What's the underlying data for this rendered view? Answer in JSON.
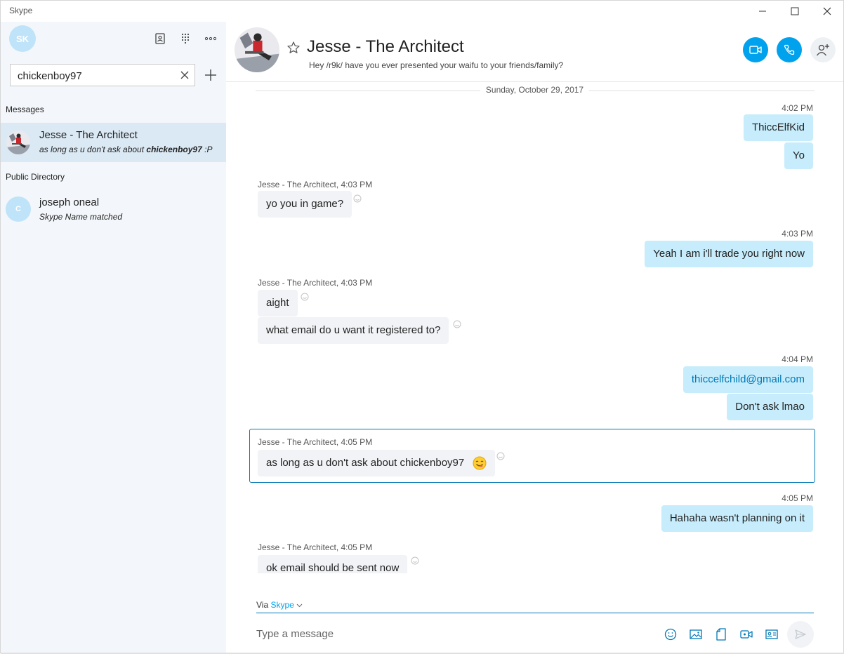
{
  "app": {
    "title": "Skype"
  },
  "window_controls": {
    "minimize_icon": "minimize-icon",
    "maximize_icon": "maximize-icon",
    "close_icon": "close-icon"
  },
  "sidebar": {
    "profile_initials": "SK",
    "icons": [
      "contacts-icon",
      "dialpad-icon",
      "more-icon"
    ],
    "search": {
      "value": "chickenboy97",
      "placeholder": ""
    },
    "messages_label": "Messages",
    "conversations": [
      {
        "name": "Jesse - The Architect",
        "preview_prefix": "as long as u don't ask about ",
        "preview_bold": "chickenboy97",
        "preview_suffix": " :P",
        "selected": true
      }
    ],
    "directory_label": "Public Directory",
    "directory_results": [
      {
        "initials": "C",
        "name": "joseph oneal",
        "match": "Skype Name matched"
      }
    ]
  },
  "header": {
    "title": "Jesse - The Architect",
    "mood": "Hey /r9k/ have you ever presented your waifu to your friends/family?",
    "buttons": [
      "video-call-button",
      "audio-call-button",
      "add-people-button"
    ]
  },
  "conversation": {
    "date": "Sunday, October 29, 2017",
    "meta": {
      "out1": "4:02 PM",
      "in1": "Jesse - The Architect, 4:03 PM",
      "out2": "4:03 PM",
      "in2": "Jesse - The Architect, 4:03 PM",
      "out3": "4:04 PM",
      "in3": "Jesse - The Architect, 4:05 PM",
      "out4": "4:05 PM",
      "in4": "Jesse - The Architect, 4:05 PM"
    },
    "messages": {
      "m1": "ThiccElfKid",
      "m2": "Yo",
      "m3": "yo you in game?",
      "m4": "Yeah I am i'll trade you right now",
      "m5": "aight",
      "m6": "what email do u want it registered to?",
      "m7": "thiccelfchild@gmail.com",
      "m8": "Don't ask lmao",
      "m9": "as long as u don't ask about chickenboy97",
      "m10": "Hahaha wasn't planning on it",
      "m11": "ok email should be sent now"
    }
  },
  "composer": {
    "via_label": "Via",
    "via_service": "Skype",
    "placeholder": "Type a message",
    "tools": [
      "emoji-icon",
      "image-icon",
      "file-icon",
      "video-message-icon",
      "contact-card-icon"
    ]
  },
  "colors": {
    "accent": "#00a2ed",
    "outgoing_bubble": "#c7edfc",
    "incoming_bubble": "#f1f3f6",
    "sidebar_bg": "#f3f6fa",
    "selected_row": "#dbe9f5"
  }
}
